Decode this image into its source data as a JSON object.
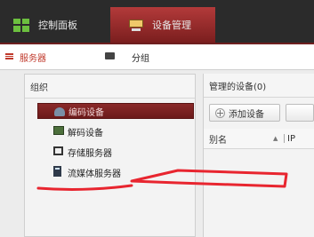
{
  "topbar": {
    "tabs": [
      {
        "label": "控制面板",
        "icon": "control-panel-grid-icon",
        "active": false
      },
      {
        "label": "设备管理",
        "icon": "device-management-icon",
        "active": true
      }
    ]
  },
  "subtabs": [
    {
      "label": "服务器",
      "icon": "list-icon",
      "active": true
    },
    {
      "label": "分组",
      "icon": "monitor-icon",
      "active": false
    }
  ],
  "left_panel": {
    "title": "组织",
    "items": [
      {
        "label": "编码设备",
        "icon": "encoder-icon",
        "selected": true
      },
      {
        "label": "解码设备",
        "icon": "decoder-icon",
        "selected": false
      },
      {
        "label": "存储服务器",
        "icon": "storage-server-icon",
        "selected": false
      },
      {
        "label": "流媒体服务器",
        "icon": "stream-media-server-icon",
        "selected": false
      }
    ]
  },
  "right_panel": {
    "title": "管理的设备(0)",
    "add_button": "添加设备",
    "columns": [
      "别名",
      "IP"
    ],
    "sort_indicator": "▲"
  },
  "colors": {
    "accent_red": "#7a1e1e",
    "annotation_red": "#e8252f",
    "topbar_bg": "#2b2b2b"
  }
}
